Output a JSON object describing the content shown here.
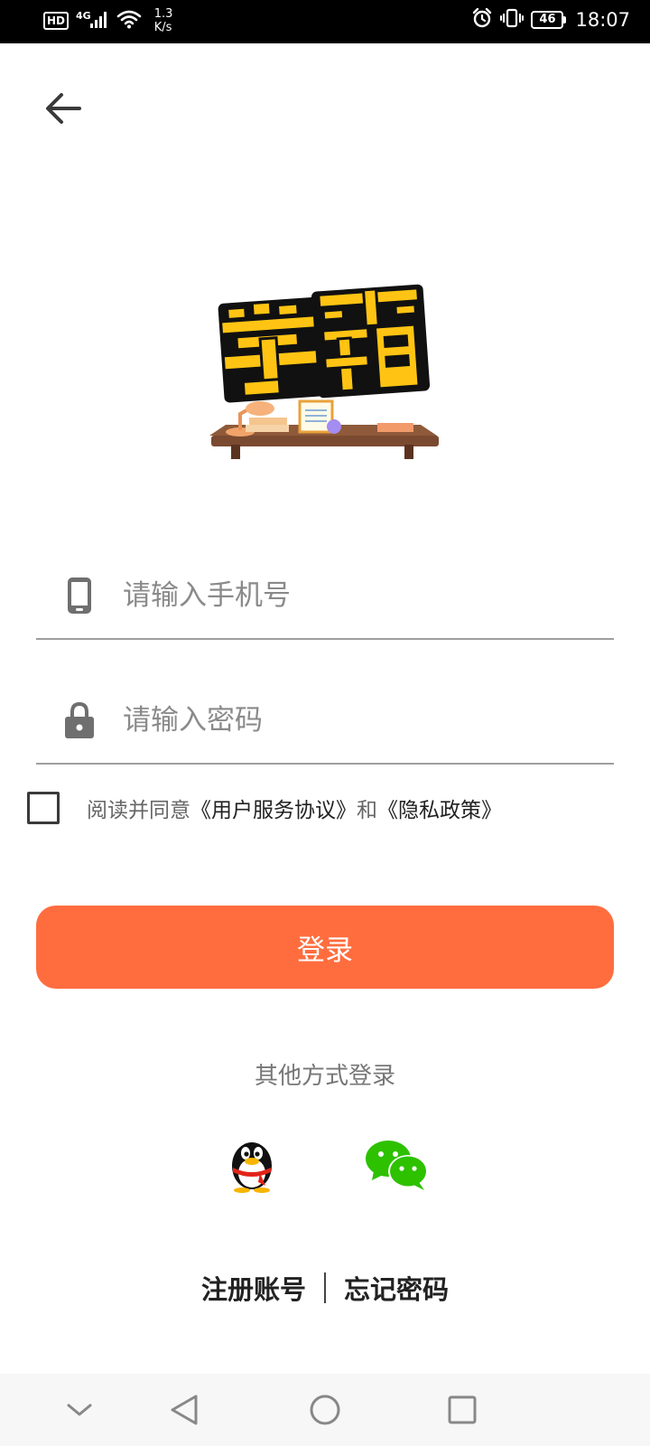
{
  "status_bar": {
    "hd_label": "HD",
    "network_type": "4G",
    "speed_value": "1.3",
    "speed_unit": "K/s",
    "battery_level": "46",
    "time": "18:07"
  },
  "logo": {
    "alt_text": "学霸"
  },
  "form": {
    "phone_placeholder": "请输入手机号",
    "phone_value": "",
    "password_placeholder": "请输入密码",
    "password_value": ""
  },
  "agreement": {
    "checked": false,
    "prefix": "阅读并同意",
    "user_agreement": "《用户服务协议》",
    "conjunction": "和",
    "privacy_policy": "《隐私政策》"
  },
  "login_button": "登录",
  "other_login": {
    "title": "其他方式登录",
    "qq_icon": "qq-penguin-icon",
    "wechat_icon": "wechat-icon"
  },
  "bottom_links": {
    "register": "注册账号",
    "forgot_password": "忘记密码"
  },
  "colors": {
    "accent": "#ff6d3f",
    "wechat_green": "#2dc100",
    "logo_yellow": "#ffc413"
  },
  "nav_bar": {
    "icons": [
      "chevron-down-icon",
      "back-triangle-icon",
      "home-circle-icon",
      "recents-square-icon"
    ]
  }
}
